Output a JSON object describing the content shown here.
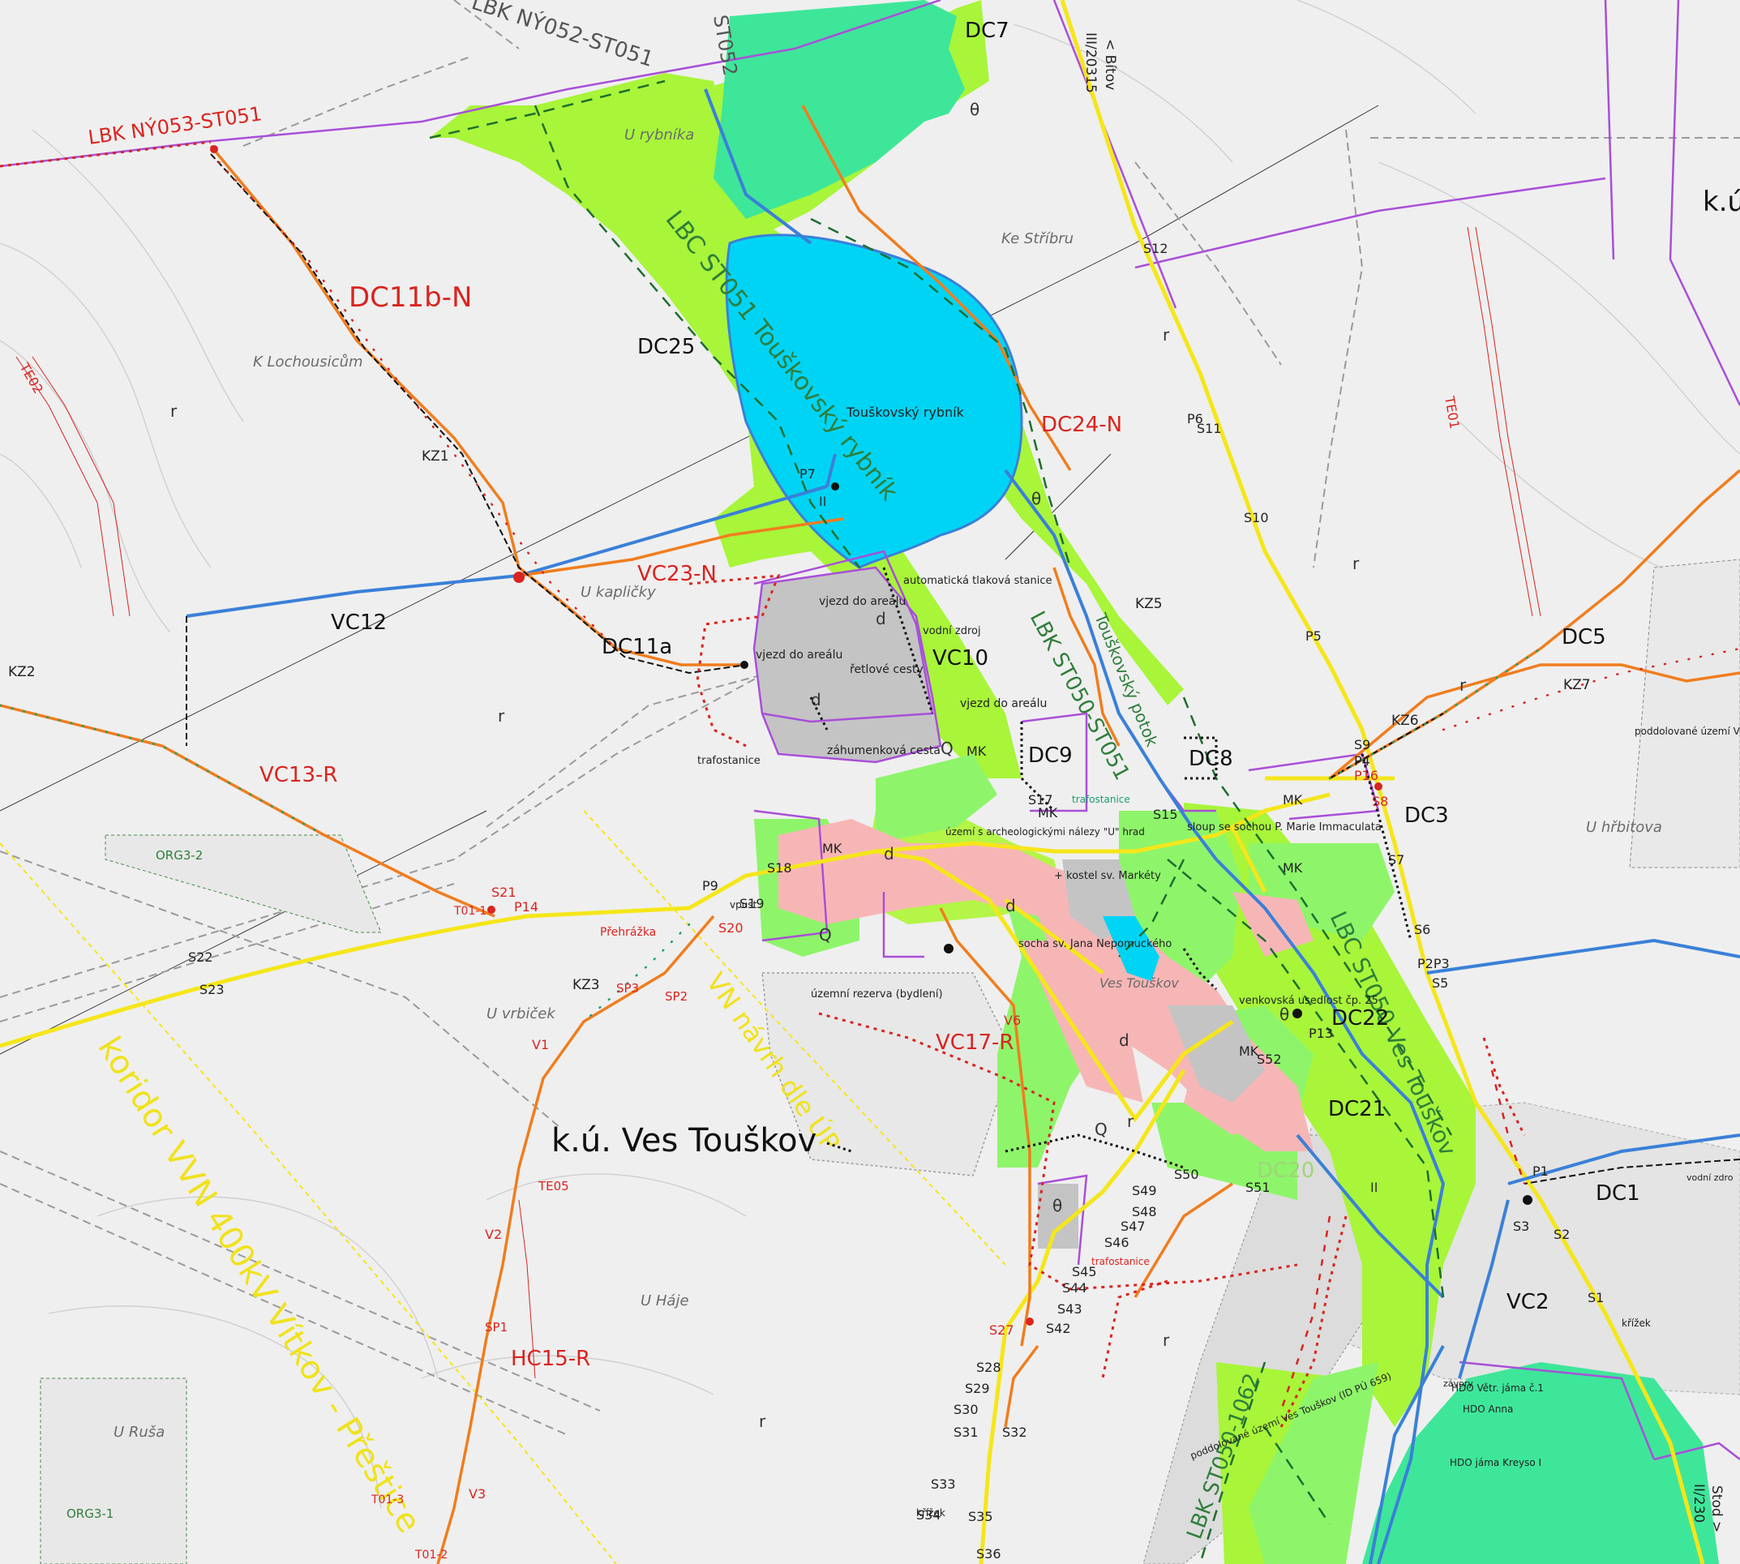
{
  "map": {
    "cadastral": {
      "main": "k.ú. Ves Touškov",
      "ne_partial": "k.ú"
    },
    "corridors": {
      "lbk_north": "LBK NÝ052-ST051",
      "lbk_nw": "LBK NÝ053-ST051",
      "lbk_top": "ST052",
      "lbc_pond": "LBC ST051 Touškovský rybník",
      "lbk_center": "LBK ST050-ST051",
      "lbk_center2": "Touškovský potok",
      "lbc_east": "LBC ST050 Ves Touškov",
      "lbk_south": "LBK ST050-1062"
    },
    "locality": {
      "u_rybnika": "U rybníka",
      "ke_stribru": "Ke Stříbru",
      "k_lochousicum": "K Lochousicům",
      "u_kaplicky": "U kapličky",
      "u_vrbicek": "U vrbiček",
      "u_haje": "U Háje",
      "u_rusa": "U Ruša",
      "u_hrbitova": "U hřbitova"
    },
    "labels_red": {
      "dc11b": "DC11b-N",
      "dc24": "DC24-N",
      "vc23": "VC23-N",
      "vc13": "VC13-R",
      "vc17": "VC17-R",
      "hc15": "HC15-R"
    },
    "labels_black": {
      "dc7": "DC7",
      "dc25": "DC25",
      "dc11a": "DC11a",
      "vc12": "VC12",
      "vc10": "VC10",
      "dc9": "DC9",
      "dc8": "DC8",
      "dc3": "DC3",
      "dc5": "DC5",
      "dc22": "DC22",
      "dc21": "DC21",
      "dc1": "DC1",
      "vc2": "VC2",
      "dc20": "DC20"
    },
    "roads": {
      "iii_20315": "III/20315",
      "bitov": "< Bítov",
      "ii_230": "II/230",
      "stod": "Stod >",
      "zahumenkova": "záhumenková cesta",
      "vjezd1": "vjezd do areálu",
      "vjezd2": "vjezd do areálu",
      "vjezd3": "vjezd do areálu",
      "retlove": "řetlové cesty"
    },
    "corridor_text": {
      "vvn_line": "VN návrh dle ÚP",
      "vvn_corridor": "koridor VVN 400kV Vítkov - Přeštice"
    },
    "water": {
      "pond": "Touškovský rybník",
      "prehrazka": "Přehrážka"
    },
    "small_notes": {
      "automaticka": "automatická tlaková stanice",
      "vodni_zdroj": "vodní zdroj",
      "trafostanice1": "trafostanice",
      "trafostanice2": "trafostanice",
      "trafostanice3": "trafostanice",
      "uzemi_arch": "území s archeologickými nálezy \"U\" hrad",
      "sloup": "sloup se sochou P. Marie Immaculata",
      "kostel": "+ kostel sv. Markéty",
      "socha": "socha sv. Jana Nepomuckého",
      "ves_touskov": "Ves Touškov",
      "venkovska": "venkovská usedlost čp. 25",
      "rezerva": "územní rezerva (bydlení)",
      "poddolovane1": "poddolované území Ves...",
      "poddolovane2": "poddolované území Ves Touškov (ID PÚ 659)",
      "hdo1": "HDO Větr. jáma č.1",
      "hdo2": "HDO Anna",
      "hdo3": "HDO jáma Kreyso I",
      "krizek1": "křížek",
      "krizek2": "křížek",
      "zavory": "závory",
      "vpust": "vpust",
      "vodni_zdroj2": "vodní zdro"
    },
    "codes": {
      "te01": "TE01",
      "te02": "TE02",
      "te05": "TE05",
      "kz1": "KZ1",
      "kz2": "KZ2",
      "kz3": "KZ3",
      "kz5": "KZ5",
      "kz6": "KZ6",
      "kz7": "KZ7",
      "org3_1": "ORG3-1",
      "org3_2": "ORG3-2",
      "t01_1": "T01-1",
      "t01_2": "T01-2",
      "t01_3": "T01-3",
      "p1": "P1",
      "p2p3": "P2P3",
      "p4": "P4",
      "p5": "P5",
      "p6": "P6",
      "p7": "P7",
      "p9": "P9",
      "p13": "P13",
      "p14": "P14",
      "p16": "P16",
      "s1": "S1",
      "s2": "S2",
      "s3": "S3",
      "s5": "S5",
      "s6": "S6",
      "s7": "S7",
      "s8": "S8",
      "s9": "S9",
      "s10": "S10",
      "s11": "S11",
      "s12": "S12",
      "s15": "S15",
      "s17": "S17",
      "s18": "S18",
      "s19": "S19",
      "s20": "S20",
      "s21": "S21",
      "s22": "S22",
      "s23": "S23",
      "s27": "S27",
      "s28": "S28",
      "s29": "S29",
      "s30": "S30",
      "s31": "S31",
      "s32": "S32",
      "s33": "S33",
      "s34": "S34",
      "s35": "S35",
      "s36": "S36",
      "s42": "S42",
      "s43": "S43",
      "s44": "S44",
      "s45": "S45",
      "s46": "S46",
      "s47": "S47",
      "s48": "S48",
      "s49": "S49",
      "s50": "S50",
      "s51": "S51",
      "s52": "S52",
      "sp1": "SP1",
      "sp2": "SP2",
      "sp3": "SP3",
      "v1": "V1",
      "v2": "V2",
      "v3": "V3",
      "v6": "V6",
      "mk": "MK"
    },
    "symbols": {
      "r": "r",
      "d": "d",
      "q": "Q",
      "theta": "θ",
      "ii": "II"
    },
    "colors": {
      "background": "#efefef",
      "lime": "#a8f53a",
      "bright_green": "#8ef56a",
      "teal_green": "#3ee69a",
      "water": "#00d4f5",
      "pink": "#f7b6b6",
      "grey_built": "#c4c4c4",
      "yellow_road": "#f5e61a",
      "orange_path": "#f07d1e",
      "blue_stream": "#3a80d8",
      "purple_border": "#a94fd8",
      "red_label": "#d9241f"
    }
  }
}
